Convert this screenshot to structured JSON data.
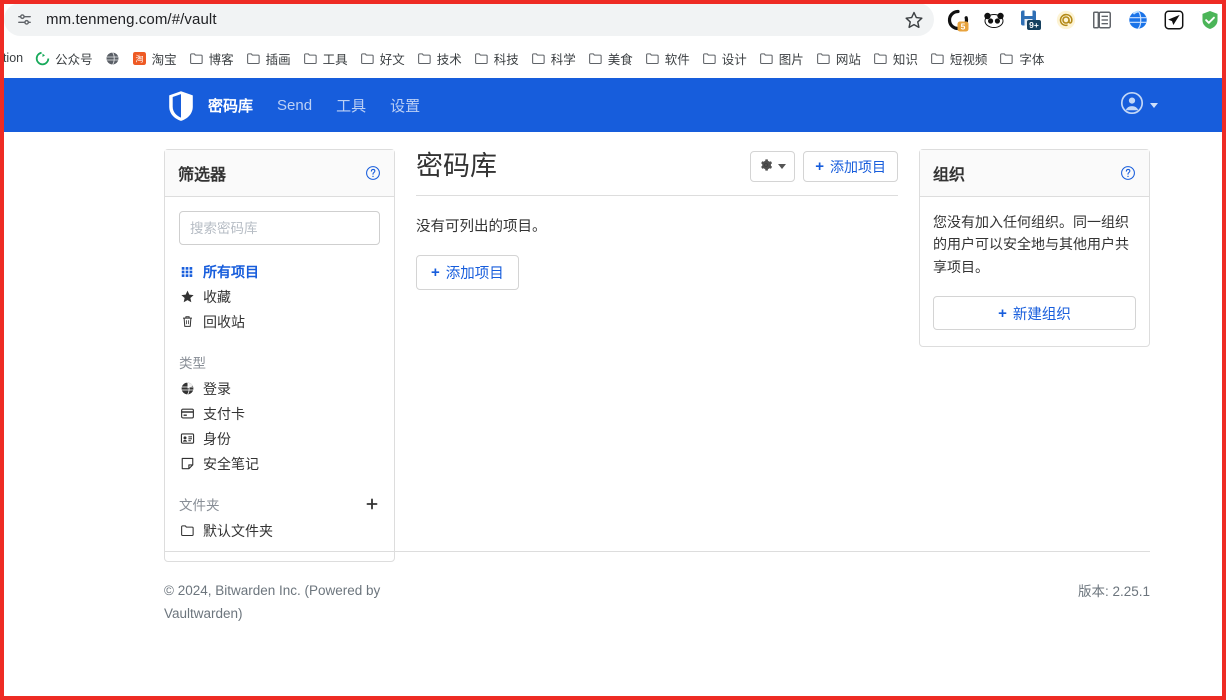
{
  "browser": {
    "url": "mm.tenmeng.com/#/vault",
    "site_settings_icon": "sliders-icon",
    "bookmark_star_icon": "star-outline-icon",
    "extensions": [
      {
        "name": "badge-counter-extension-icon",
        "badge": "5"
      },
      {
        "name": "panda-extension-icon",
        "badge": ""
      },
      {
        "name": "save-page-extension-icon",
        "badge": "9+"
      },
      {
        "name": "at-sign-extension-icon",
        "badge": ""
      },
      {
        "name": "copy-pages-extension-icon",
        "badge": ""
      },
      {
        "name": "globe-extension-icon",
        "badge": ""
      },
      {
        "name": "paper-plane-extension-icon",
        "badge": ""
      },
      {
        "name": "green-shield-extension-icon",
        "badge": ""
      }
    ],
    "bookmarks": [
      {
        "label": "otion",
        "icon": "clipped-text"
      },
      {
        "label": "公众号",
        "icon": "green-swirl-icon"
      },
      {
        "label": "",
        "icon": "grey-globe-icon"
      },
      {
        "label": "淘宝",
        "icon": "taobao-icon"
      },
      {
        "label": "博客",
        "icon": "folder-icon"
      },
      {
        "label": "插画",
        "icon": "folder-icon"
      },
      {
        "label": "工具",
        "icon": "folder-icon"
      },
      {
        "label": "好文",
        "icon": "folder-icon"
      },
      {
        "label": "技术",
        "icon": "folder-icon"
      },
      {
        "label": "科技",
        "icon": "folder-icon"
      },
      {
        "label": "科学",
        "icon": "folder-icon"
      },
      {
        "label": "美食",
        "icon": "folder-icon"
      },
      {
        "label": "软件",
        "icon": "folder-icon"
      },
      {
        "label": "设计",
        "icon": "folder-icon"
      },
      {
        "label": "图片",
        "icon": "folder-icon"
      },
      {
        "label": "网站",
        "icon": "folder-icon"
      },
      {
        "label": "知识",
        "icon": "folder-icon"
      },
      {
        "label": "短视频",
        "icon": "folder-icon"
      },
      {
        "label": "字体",
        "icon": "folder-icon"
      }
    ]
  },
  "nav": {
    "logo_icon": "bitwarden-shield-icon",
    "links": [
      {
        "label": "密码库",
        "active": true
      },
      {
        "label": "Send",
        "active": false
      },
      {
        "label": "工具",
        "active": false
      },
      {
        "label": "设置",
        "active": false
      }
    ],
    "account_icon": "user-circle-icon",
    "brand_color": "#175ddc"
  },
  "filters": {
    "title": "筛选器",
    "help_icon": "question-circle-icon",
    "search_placeholder": "搜索密码库",
    "search_value": "",
    "main_items": [
      {
        "label": "所有项目",
        "icon": "grid-icon",
        "active": true
      },
      {
        "label": "收藏",
        "icon": "star-icon",
        "active": false
      },
      {
        "label": "回收站",
        "icon": "trash-icon",
        "active": false
      }
    ],
    "type_group": {
      "label": "类型",
      "items": [
        {
          "label": "登录",
          "icon": "globe-icon"
        },
        {
          "label": "支付卡",
          "icon": "credit-card-icon"
        },
        {
          "label": "身份",
          "icon": "id-card-icon"
        },
        {
          "label": "安全笔记",
          "icon": "sticky-note-icon"
        }
      ]
    },
    "folder_group": {
      "label": "文件夹",
      "add_icon": "plus-icon",
      "items": [
        {
          "label": "默认文件夹",
          "icon": "folder-icon"
        }
      ]
    }
  },
  "main": {
    "title": "密码库",
    "gear_icon": "gear-icon",
    "gear_caret_icon": "caret-down-icon",
    "add_item_label": "添加项目",
    "empty_message": "没有可列出的项目。",
    "add_item_big_label": "添加项目"
  },
  "organizations": {
    "title": "组织",
    "help_icon": "question-circle-icon",
    "description": "您没有加入任何组织。同一组织的用户可以安全地与其他用户共享项目。",
    "new_org_label": "新建组织"
  },
  "footer": {
    "copyright": "© 2024, Bitwarden Inc. (Powered by Vaultwarden)",
    "version": "版本: 2.25.1"
  },
  "overlay": {
    "frame_color": "#ee2b24"
  }
}
